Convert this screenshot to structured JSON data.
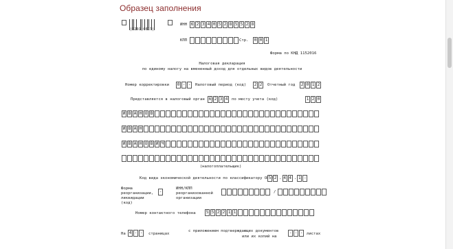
{
  "header": {
    "title": "Образец заполнения"
  },
  "form": {
    "inn_label": "ИНН",
    "inn_value": "623405285528",
    "kpp_label": "КПП",
    "page_label": "Стр.",
    "page_value": "001",
    "barcode_text": "|0291|0017|",
    "form_code": "Форма по КНД 1152016",
    "title_line1": "Налоговая декларация",
    "title_line2": "по единому налогу на вмененный доход для отдельных видов деятельности",
    "correction_label": "Номер корректировки",
    "correction_value": "0--",
    "tax_period_label": "Налоговый период (код)",
    "tax_period_value": "22",
    "report_year_label": "Отчетный год",
    "report_year_value": "2012",
    "tax_authority_label": "Представляется в налоговый орган (код)",
    "tax_authority_value": "6234",
    "location_label": "по месту учета (код)",
    "location_value": "120",
    "surname": "ИВАНОВ",
    "name": "ИВАН",
    "patronymic": "ИВАНОВИЧ",
    "taxpayer_caption": "(налогоплательщик)",
    "okved_label": "Код вида экономической деятельности по классификатору ОКВЭД",
    "okved_value": "52.44.1",
    "reorg_label_1": "Форма",
    "reorg_label_2": "реорганизации,",
    "reorg_label_3": "ликвидации",
    "reorg_label_4": "(код)",
    "reorg_value": "-",
    "reorg_inn_label_1": "ИНН/КПП",
    "reorg_inn_label_2": "реорганизованной",
    "reorg_inn_label_3": "организации",
    "phone_label": "Номер контактного телефона",
    "phone_value": "552211",
    "pages_prefix": "На",
    "pages_value": "4--",
    "pages_label": "страницах",
    "attach_label_1": "с приложением подтверждающих документов",
    "attach_label_2": "или их копий на",
    "attach_value": "---",
    "sheets_label": "листах"
  }
}
